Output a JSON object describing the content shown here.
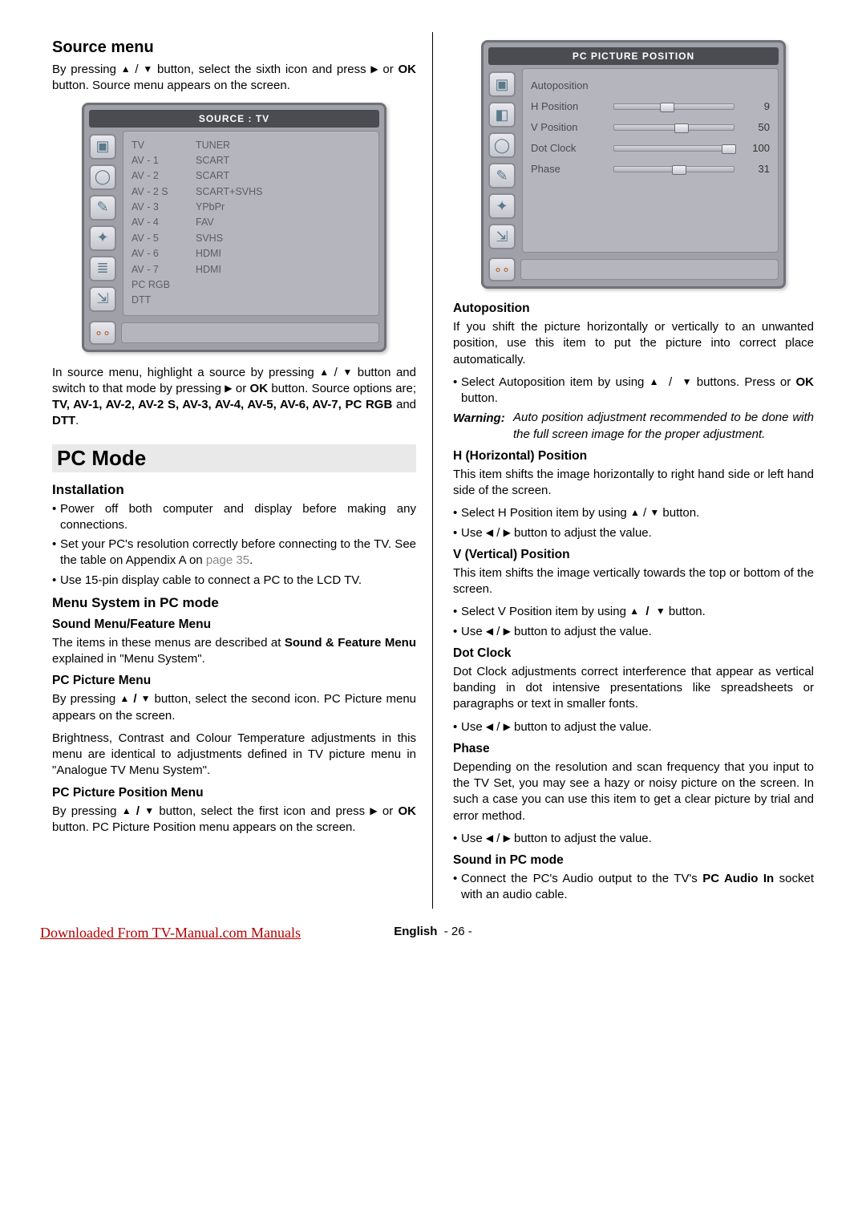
{
  "left": {
    "h_source_menu": "Source menu",
    "p_src1a": "By pressing ",
    "p_src1b": " button, select the sixth icon and press ",
    "p_src1c": " or ",
    "ok": "OK",
    "p_src1d": " button. Source menu appears on the screen.",
    "osd_source_title": "SOURCE : TV",
    "source_list": [
      {
        "name": "TV",
        "type": "TUNER"
      },
      {
        "name": "AV - 1",
        "type": "SCART"
      },
      {
        "name": "AV - 2",
        "type": "SCART"
      },
      {
        "name": "AV - 2 S",
        "type": "SCART+SVHS"
      },
      {
        "name": "AV - 3",
        "type": "YPbPr"
      },
      {
        "name": "AV - 4",
        "type": "FAV"
      },
      {
        "name": "AV - 5",
        "type": "SVHS"
      },
      {
        "name": "AV - 6",
        "type": "HDMI"
      },
      {
        "name": "AV - 7",
        "type": "HDMI"
      },
      {
        "name": "PC RGB",
        "type": ""
      },
      {
        "name": "DTT",
        "type": ""
      }
    ],
    "p_src2a": "In source menu, highlight a source by pressing ",
    "p_src2b": " button and switch to that mode by pressing ",
    "p_src2c": " or ",
    "p_src2d": " button. Source options are; ",
    "src_bold": "TV, AV-1, AV-2, AV-2 S, AV-3, AV-4, AV-5, AV-6, AV-7, PC RGB",
    "src_and": " and ",
    "src_dtt": "DTT",
    "h_pcmode": "PC Mode",
    "h_install": "Installation",
    "inst1": "Power off both computer and display before making any connections.",
    "inst2a": "Set your PC's resolution correctly before connecting to the TV.  See the table on Appendix A on ",
    "inst2b": "page 35",
    "inst2c": ".",
    "inst3": "Use 15-pin display cable to connect a PC to the LCD TV.",
    "h_menusys": "Menu System in PC mode",
    "h_soundfeat": "Sound Menu/Feature Menu",
    "p_soundfeat_a": "The items in these menus are described at ",
    "p_soundfeat_b": "Sound & Feature Menu",
    "p_soundfeat_c": " explained in \"Menu System\".",
    "h_pcpic": "PC Picture Menu",
    "p_pcpic1a": "By pressing ",
    "p_pcpic1b": " button, select the second icon. PC Picture menu appears on the screen.",
    "p_pcpic2": "Brightness, Contrast and Colour Temperature adjustments in this menu are identical to adjustments defined in TV picture menu in \"Analogue TV Menu System\".",
    "h_pcpicpos": "PC Picture Position Menu",
    "p_pcpicpos_a": "By pressing ",
    "p_pcpicpos_b": " button, select the first icon and press ",
    "p_pcpicpos_c": " or ",
    "p_pcpicpos_d": " button. PC Picture Position menu appears on the screen."
  },
  "right": {
    "osd_pp_title": "PC PICTURE POSITION",
    "pp_rows": [
      {
        "label": "Autoposition",
        "val": "",
        "pct": null
      },
      {
        "label": "H Position",
        "val": "9",
        "pct": 38
      },
      {
        "label": "V Position",
        "val": "50",
        "pct": 50
      },
      {
        "label": "Dot Clock",
        "val": "100",
        "pct": 90
      },
      {
        "label": "Phase",
        "val": "31",
        "pct": 48
      }
    ],
    "h_auto": "Autoposition",
    "p_auto": "If you shift the picture horizontally or vertically to an unwanted position, use this item to put the picture into correct place automatically.",
    "b_auto_a": "Select Autoposition item by using ",
    "b_auto_b": " buttons. Press or ",
    "b_auto_c": " button.",
    "warn_label": "Warning:",
    "warn_txt": "Auto position adjustment recommended to be done with the full screen image for the proper adjustment.",
    "h_hpos": "H (Horizontal) Position",
    "p_hpos": "This item shifts the image horizontally to right hand side or left hand side of the screen.",
    "b_hpos_a": "Select H Position item by using ",
    "b_hpos_b": " button.",
    "b_adj_a": "Use ",
    "b_adj_b": " button to adjust the value.",
    "h_vpos": "V (Vertical) Position",
    "p_vpos": "This item shifts the image vertically towards the top or bottom of the screen.",
    "b_vpos_a": "Select V Position item by using ",
    "b_vpos_b": " button.",
    "h_dot": "Dot Clock",
    "p_dot": "Dot Clock adjustments correct interference that appear as vertical banding in dot intensive presentations like spreadsheets or paragraphs or text in smaller fonts.",
    "h_phase": "Phase",
    "p_phase": "Depending on the resolution and scan frequency that you input to the TV Set, you may see a hazy or noisy picture on the screen. In such a case you can use this item to get a clear picture by trial and error method.",
    "h_sound": "Sound in PC mode",
    "b_sound_a": "Connect the PC's Audio output to the TV's ",
    "b_sound_b": "PC Audio In",
    "b_sound_c": " socket with an audio cable."
  },
  "footer": {
    "left": "Downloaded From TV-Manual.com Manuals",
    "lang": "English",
    "page": "- 26 -"
  }
}
